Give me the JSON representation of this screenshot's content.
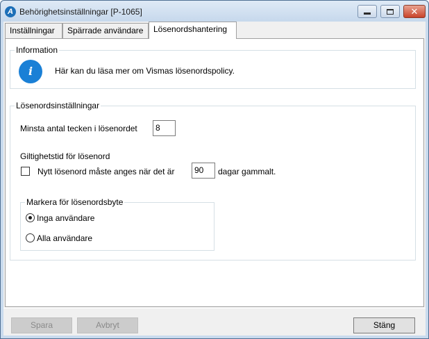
{
  "window": {
    "title": "Behörighetsinställningar [P-1065]",
    "app_icon": "visma-logo-icon"
  },
  "tabs": [
    {
      "label": "Inställningar",
      "active": false
    },
    {
      "label": "Spärrade användare",
      "active": false
    },
    {
      "label": "Lösenordshantering",
      "active": true
    }
  ],
  "information": {
    "group_label": "Information",
    "icon": "info-icon",
    "icon_glyph": "i",
    "text": "Här kan du läsa mer om Vismas lösenordspolicy."
  },
  "password_settings": {
    "group_label": "Lösenordsinställningar",
    "min_chars_label": "Minsta antal tecken i lösenordet",
    "min_chars_value": "8",
    "validity_label": "Giltighetstid för lösenord",
    "validity_checkbox_label": "Nytt lösenord måste anges när det är",
    "validity_checked": false,
    "validity_days": "90",
    "validity_suffix": "dagar gammalt.",
    "mark_group": {
      "label": "Markera för lösenordsbyte",
      "options": [
        {
          "label": "Inga användare",
          "selected": true
        },
        {
          "label": "Alla användare",
          "selected": false
        }
      ]
    }
  },
  "buttons": {
    "save": "Spara",
    "cancel": "Avbryt",
    "close": "Stäng"
  },
  "colors": {
    "accent": "#1a80d6",
    "titlebar": "#c9dbee"
  }
}
